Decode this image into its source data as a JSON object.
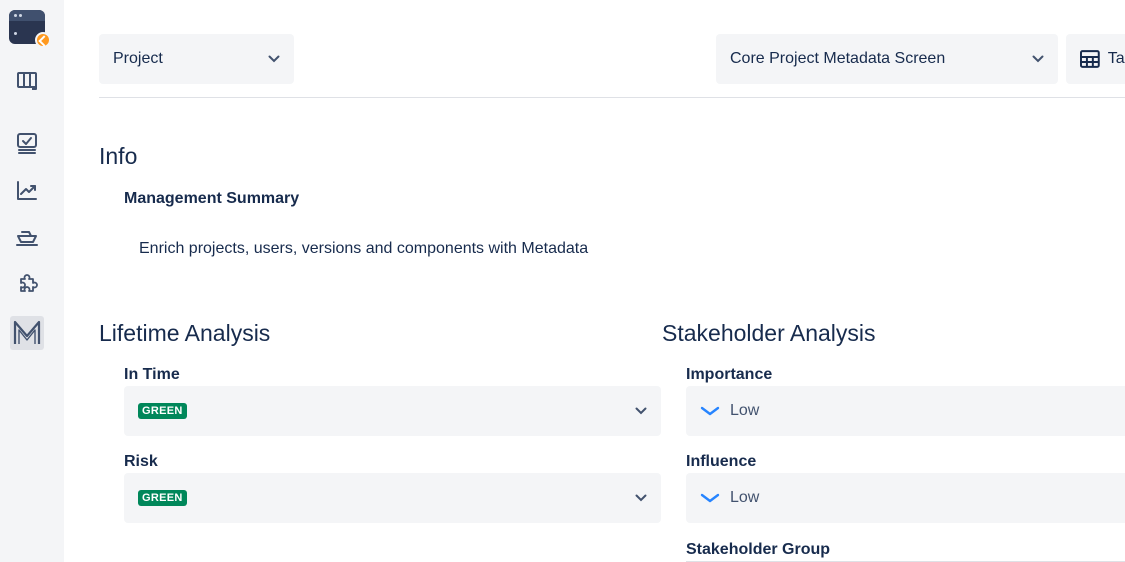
{
  "header": {
    "project_select": "Project",
    "screen_select": "Core Project Metadata Screen",
    "table_button": "Table"
  },
  "info": {
    "title": "Info",
    "management_summary_label": "Management Summary",
    "management_summary_value": "Enrich projects, users, versions and components with Metadata"
  },
  "lifetime": {
    "title": "Lifetime Analysis",
    "in_time_label": "In Time",
    "in_time_value": "GREEN",
    "risk_label": "Risk",
    "risk_value": "GREEN"
  },
  "stakeholder": {
    "title": "Stakeholder Analysis",
    "importance_label": "Importance",
    "importance_value": "Low",
    "influence_label": "Influence",
    "influence_value": "Low",
    "group_label": "Stakeholder Group"
  },
  "colors": {
    "accent": "#0052cc",
    "status_green": "#00875a",
    "field_bg": "#f4f5f7",
    "text": "#172b4d"
  }
}
